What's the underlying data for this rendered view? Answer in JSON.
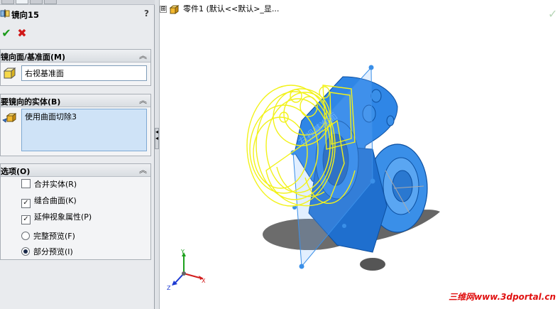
{
  "feature": {
    "title": "镜向15",
    "help": "?"
  },
  "actions": {
    "ok": "✔",
    "cancel": "✖"
  },
  "groups": {
    "mirror_face": {
      "label": "镜向面/基准面(M)",
      "value": "右视基准面"
    },
    "bodies": {
      "label": "要镜向的实体(B)",
      "value": "使用曲面切除3"
    },
    "options": {
      "label": "选项(O)",
      "items": [
        {
          "label": "合并实体(R)",
          "checked": false
        },
        {
          "label": "缝合曲面(K)",
          "checked": true
        },
        {
          "label": "延伸视象属性(P)",
          "checked": true
        }
      ],
      "preview": [
        {
          "label": "完整预览(F)",
          "selected": false
        },
        {
          "label": "部分预览(I)",
          "selected": true
        }
      ]
    }
  },
  "tree": {
    "expander": "⊞",
    "label": "零件1  (默认<<默认>_显..."
  },
  "viewport": {
    "triad": {
      "x": "X",
      "y": "Y",
      "z": "Z"
    },
    "watermark": "三维网www.3dportal.cn"
  },
  "colors": {
    "accent_blue": "#2a7fe0",
    "preview_yellow": "#f2f21a",
    "ok_green": "#1a9a1a",
    "cancel_red": "#d01818"
  }
}
